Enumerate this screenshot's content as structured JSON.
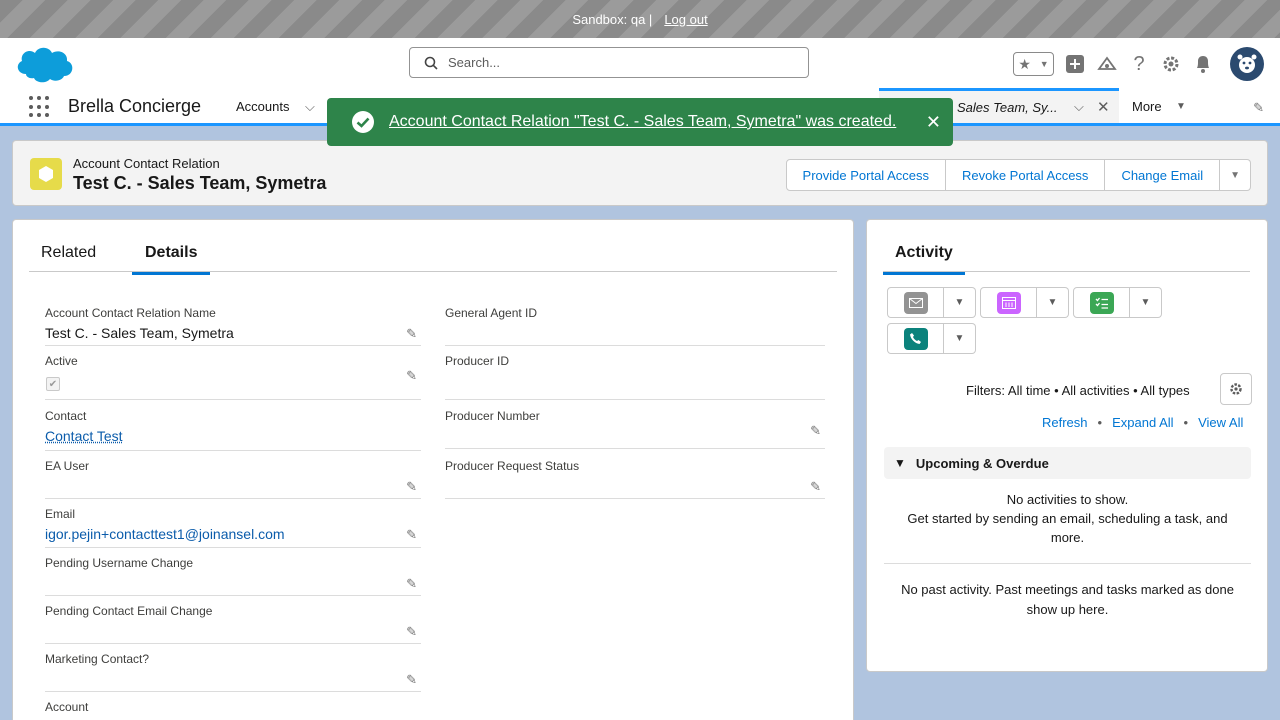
{
  "sandbox": {
    "label": "Sandbox: qa |",
    "logout": "Log out"
  },
  "search": {
    "placeholder": "Search..."
  },
  "nav": {
    "app_name": "Brella Concierge",
    "accounts": "Accounts",
    "active_tab": "Sales Team, Sy...",
    "more": "More"
  },
  "toast": {
    "message": "Account Contact Relation \"Test C. - Sales Team, Symetra\" was created."
  },
  "record": {
    "type": "Account Contact Relation",
    "title": "Test C. - Sales Team, Symetra",
    "actions": [
      "Provide Portal Access",
      "Revoke Portal Access",
      "Change Email"
    ]
  },
  "detail_tabs": {
    "related": "Related",
    "details": "Details"
  },
  "fields_left": [
    {
      "label": "Account Contact Relation Name",
      "value": "Test C. - Sales Team, Symetra"
    },
    {
      "label": "Active",
      "value": ""
    },
    {
      "label": "Contact",
      "value": "Contact Test"
    },
    {
      "label": "EA User",
      "value": ""
    },
    {
      "label": "Email",
      "value": "igor.pejin+contacttest1@joinansel.com"
    },
    {
      "label": "Pending Username Change",
      "value": ""
    },
    {
      "label": "Pending Contact Email Change",
      "value": ""
    },
    {
      "label": "Marketing Contact?",
      "value": ""
    },
    {
      "label": "Account",
      "value": ""
    }
  ],
  "fields_right": [
    {
      "label": "General Agent ID",
      "value": ""
    },
    {
      "label": "Producer ID",
      "value": ""
    },
    {
      "label": "Producer Number",
      "value": ""
    },
    {
      "label": "Producer Request Status",
      "value": ""
    }
  ],
  "activity": {
    "title": "Activity",
    "filters": "Filters: All time • All activities • All types",
    "refresh": "Refresh",
    "expand_all": "Expand All",
    "view_all": "View All",
    "sep": "•",
    "upcoming": "Upcoming & Overdue",
    "no_activities": "No activities to show.",
    "get_started": "Get started by sending an email, scheduling a task, and more.",
    "no_past": "No past activity. Past meetings and tasks marked as done show up here."
  },
  "colors": {
    "brand": "#0176d3",
    "toast": "#2e844a",
    "record_icon": "#e6db4a"
  }
}
